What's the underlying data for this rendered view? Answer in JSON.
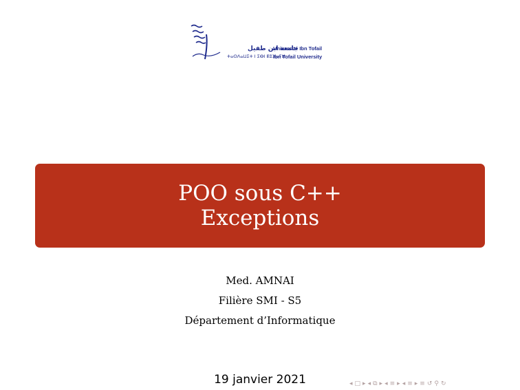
{
  "logo": {
    "arabic_name": "جامعة ابن طفيل",
    "french_name": "Université Ibn Tofail",
    "tifinagh_name": "ⵜⴰⵙⴷⴰⵡⵉⵜ ⵏ ⵉⴱⵏ ⵟⵓⴼⴰⵢⵍ",
    "english_name": "Ibn Tofail University"
  },
  "title": {
    "line1": "POO sous C++",
    "line2": "Exceptions"
  },
  "author": {
    "name": "Med. AMNAI",
    "class": "Filière SMI - S5",
    "department": "Département d’Informatique"
  },
  "date": "19 janvier 2021",
  "navigation": {
    "icons": [
      "nav-frame-back-icon",
      "nav-frame-forward-icon",
      "nav-subsection-back-icon",
      "nav-subsection-forward-icon",
      "nav-section-back-icon",
      "nav-section-forward-icon",
      "nav-align-icon",
      "nav-search-icon"
    ],
    "color": "#b5a3a3"
  },
  "colors": {
    "title_box": "#b8311a",
    "logo": "#1e2a8c"
  }
}
